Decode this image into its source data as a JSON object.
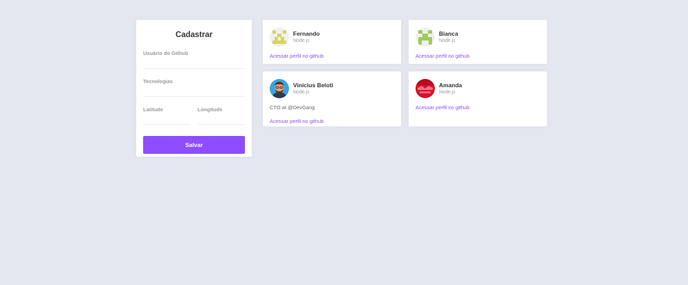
{
  "form": {
    "title": "Cadastrar",
    "github_username_label": "Usuário do Github",
    "techs_label": "Tecnologias",
    "latitude_label": "Latitude",
    "longitude_label": "Longitude",
    "submit_label": "Salvar"
  },
  "colors": {
    "accent": "#8e4dff",
    "background": "#e5e7f0"
  },
  "devs": [
    {
      "name": "Fernando",
      "techs": "Node.js",
      "bio": "",
      "link_label": "Acessar perfil no github",
      "avatar": "identicon-yellow"
    },
    {
      "name": "Bianca",
      "techs": "Node.js",
      "bio": "",
      "link_label": "Acessar perfil no github",
      "avatar": "identicon-green"
    },
    {
      "name": "Vinicius Beloti",
      "techs": "Node.js",
      "bio": "CTO at @DevGang",
      "link_label": "Acessar perfil no github",
      "avatar": "cartoon-portrait"
    },
    {
      "name": "Amanda",
      "techs": "Node.js",
      "bio": "",
      "link_label": "Acessar perfil no github",
      "avatar": "red-photo"
    }
  ]
}
